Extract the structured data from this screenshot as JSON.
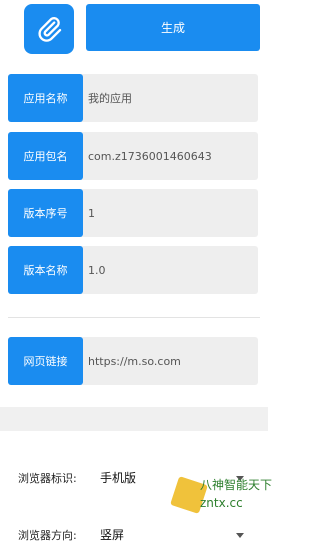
{
  "header": {
    "generate_label": "生成",
    "app_icon": "paperclip-icon"
  },
  "fields": [
    {
      "label": "应用名称",
      "value": "我的应用"
    },
    {
      "label": "应用包名",
      "value": "com.z1736001460643"
    },
    {
      "label": "版本序号",
      "value": "1"
    },
    {
      "label": "版本名称",
      "value": "1.0"
    },
    {
      "label": "网页链接",
      "value": "https://m.so.com"
    }
  ],
  "settings": {
    "browser_id": {
      "label": "浏览器标识:",
      "value": "手机版"
    },
    "orientation": {
      "label": "浏览器方向:",
      "value": "竖屏"
    }
  },
  "watermark": {
    "line1": "八神智能天下",
    "line2": "zntx.cc"
  },
  "colors": {
    "accent": "#1a8cf0",
    "field_bg": "#eeeeee"
  }
}
